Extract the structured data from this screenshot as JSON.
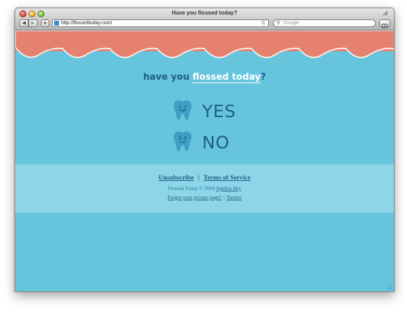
{
  "window": {
    "title": "Have you flossed today?"
  },
  "toolbar": {
    "back_label": "◀",
    "forward_label": "▶",
    "add_label": "+",
    "url": "http://flossedtoday.com/",
    "reload_label": "C",
    "search_placeholder": "Google"
  },
  "page": {
    "tagline_prefix": "have you ",
    "tagline_highlight": "flossed today",
    "tagline_suffix": "?",
    "yes_label": "YES",
    "no_label": "NO"
  },
  "footer": {
    "unsubscribe": "Unsubscribe",
    "separator": "|",
    "terms": "Terms of Service",
    "copyright": "Flossed Today © 2009",
    "company": "Spitfire Sky",
    "forgot": "Forgot your private page?",
    "twitter": "Twitter"
  },
  "colors": {
    "page_bg": "#66c4dd",
    "gum": "#e6806f",
    "footer_band": "#8dd6e8",
    "text_dark": "#1f6287",
    "tooth": "#3d9fc4"
  },
  "icons": {
    "yes_tooth": "happy-tooth-icon",
    "no_tooth": "sad-tooth-icon",
    "search": "magnifier-icon",
    "favicon": "site-favicon-icon",
    "bookmarks": "bookmarks-icon"
  }
}
